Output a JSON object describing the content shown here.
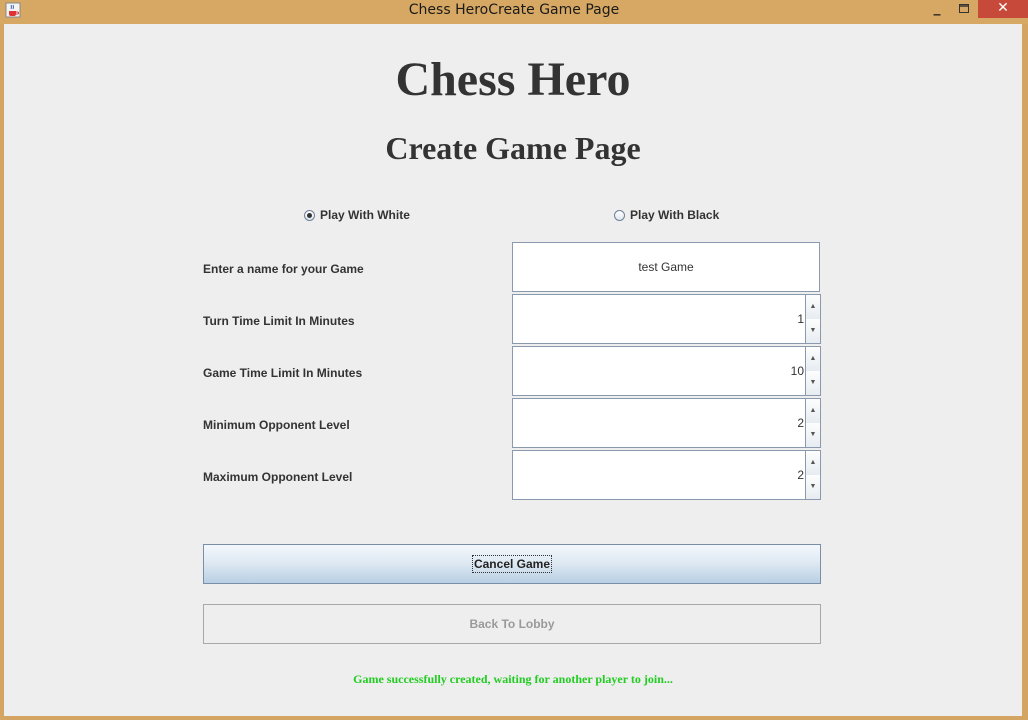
{
  "window": {
    "title": "Chess HeroCreate Game Page",
    "minimize_glyph": "_",
    "maximize_glyph": "□",
    "close_glyph": "✕"
  },
  "header": {
    "app_title": "Chess Hero",
    "page_title": "Create Game Page"
  },
  "color_choice": {
    "white_label": "Play With White",
    "black_label": "Play With Black",
    "selected": "white"
  },
  "form": {
    "game_name": {
      "label": "Enter a name for your Game",
      "value": "test Game"
    },
    "turn_time": {
      "label": "Turn Time Limit In Minutes",
      "value": "1"
    },
    "game_time": {
      "label": "Game Time Limit In Minutes",
      "value": "10"
    },
    "min_level": {
      "label": "Minimum Opponent Level",
      "value": "2"
    },
    "max_level": {
      "label": "Maximum Opponent Level",
      "value": "2"
    }
  },
  "actions": {
    "cancel_label": "Cancel Game",
    "back_label": "Back To Lobby"
  },
  "status": {
    "message": "Game successfully created, waiting for another player to join..."
  },
  "icons": {
    "app": "java-cup-icon",
    "spin_up": "▲",
    "spin_down": "▼"
  },
  "colors": {
    "window_frame": "#d6a863",
    "close_button": "#c7493a",
    "status_text": "#22cc22",
    "content_bg": "#eeeeee"
  }
}
